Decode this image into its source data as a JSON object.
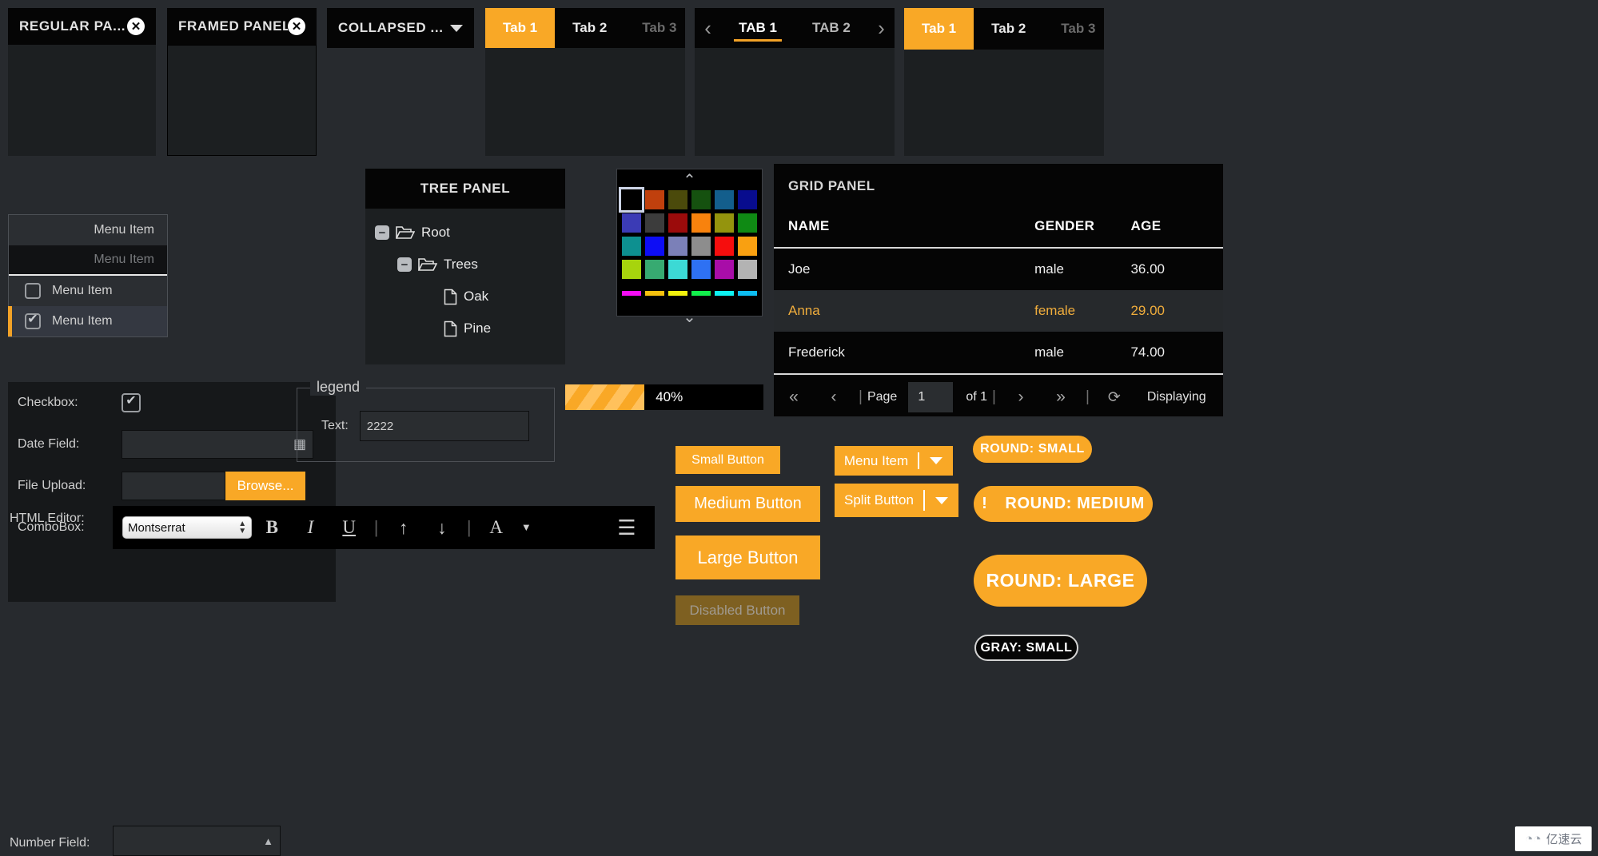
{
  "theme": {
    "accent": "#f9a826",
    "bg": "#272a2e",
    "panel_bg": "#1c1f21",
    "header_bg": "#050505",
    "text": "#d4d4d4"
  },
  "panels": {
    "regular": {
      "title": "REGULAR PA...",
      "close_icon": "close-circle-icon"
    },
    "framed": {
      "title": "FRAMED PANEL",
      "close_icon": "close-circle-icon"
    },
    "collapsed": {
      "title": "COLLAPSED ...",
      "expand_icon": "chevron-down-icon"
    },
    "tree": {
      "title": "TREE PANEL"
    },
    "grid": {
      "title": "GRID PANEL"
    }
  },
  "tabs_basic": {
    "items": [
      {
        "label": "Tab 1",
        "state": "active"
      },
      {
        "label": "Tab 2",
        "state": "normal"
      },
      {
        "label": "Tab 3",
        "state": "disabled"
      }
    ]
  },
  "tabs_scroll": {
    "prev_icon": "chevron-left-icon",
    "next_icon": "chevron-right-icon",
    "items": [
      {
        "label": "TAB 1",
        "state": "active"
      },
      {
        "label": "TAB 2",
        "state": "normal"
      }
    ]
  },
  "tabs_third": {
    "items": [
      {
        "label": "Tab 1",
        "state": "active"
      },
      {
        "label": "Tab 2",
        "state": "normal"
      },
      {
        "label": "Tab 3",
        "state": "disabled"
      }
    ]
  },
  "menu": {
    "items": [
      {
        "label": "Menu Item",
        "type": "plain",
        "state": "normal"
      },
      {
        "label": "Menu Item",
        "type": "plain",
        "state": "disabled"
      },
      {
        "label": "Menu Item",
        "type": "checkbox",
        "checked": false,
        "state": "normal"
      },
      {
        "label": "Menu Item",
        "type": "checkbox",
        "checked": true,
        "state": "selected"
      }
    ]
  },
  "form": {
    "checkbox": {
      "label": "Checkbox:",
      "checked": true
    },
    "date": {
      "label": "Date Field:",
      "value": "",
      "icon": "calendar-icon"
    },
    "file": {
      "label": "File Upload:",
      "value": "",
      "button": "Browse..."
    },
    "combo": {
      "label": "ComboBox:",
      "value": "",
      "icon": "chevron-down-icon"
    },
    "html_editor": {
      "label": "HTML Editor:"
    },
    "number": {
      "label": "Number Field:",
      "value": ""
    }
  },
  "editor": {
    "font": "Montserrat",
    "buttons": [
      {
        "name": "bold-icon",
        "glyph": "B"
      },
      {
        "name": "italic-icon",
        "glyph": "I"
      },
      {
        "name": "underline-icon",
        "glyph": "U"
      },
      {
        "name": "increase-font-size-icon",
        "glyph": "↑"
      },
      {
        "name": "decrease-font-size-icon",
        "glyph": "↓"
      },
      {
        "name": "font-color-icon",
        "glyph": "A"
      },
      {
        "name": "source-edit-icon",
        "glyph": "☰"
      }
    ]
  },
  "tree": {
    "nodes": [
      {
        "label": "Root",
        "depth": 0,
        "type": "folder",
        "expanded": true
      },
      {
        "label": "Trees",
        "depth": 1,
        "type": "folder",
        "expanded": true
      },
      {
        "label": "Oak",
        "depth": 2,
        "type": "leaf"
      },
      {
        "label": "Pine",
        "depth": 2,
        "type": "leaf"
      }
    ]
  },
  "color_picker": {
    "up_icon": "chevron-up-icon",
    "down_icon": "chevron-down-icon",
    "selected_index": 0,
    "rows": [
      [
        "#000000",
        "#c0400d",
        "#4b4a0b",
        "#15510f",
        "#135e8c",
        "#080c8e"
      ],
      [
        "#3b3bb5",
        "#3c3c3c",
        "#9b0b0b",
        "#f8820d",
        "#94940d",
        "#0f8a14"
      ],
      [
        "#0d9090",
        "#0d0df5",
        "#7b80b8",
        "#8d8d8d",
        "#f60d0d",
        "#f9a011"
      ],
      [
        "#a7d40d",
        "#37aa71",
        "#3cd9d5",
        "#2e71f3",
        "#a80da8",
        "#b3b3b3"
      ]
    ],
    "strips": [
      "#f60df6",
      "#f5c10d",
      "#f1f10d",
      "#12ef4c",
      "#0df2f2",
      "#0dbdf2"
    ]
  },
  "grid": {
    "columns": [
      "NAME",
      "GENDER",
      "AGE"
    ],
    "rows": [
      {
        "name": "Joe",
        "gender": "male",
        "age": "36.00",
        "highlight": false
      },
      {
        "name": "Anna",
        "gender": "female",
        "age": "29.00",
        "highlight": true
      },
      {
        "name": "Frederick",
        "gender": "male",
        "age": "74.00",
        "highlight": false
      }
    ],
    "pager": {
      "first_icon": "double-chevron-left-icon",
      "prev_icon": "chevron-left-icon",
      "page_label": "Page",
      "page_value": "1",
      "of_label": "of 1",
      "next_icon": "chevron-right-icon",
      "last_icon": "double-chevron-right-icon",
      "refresh_icon": "refresh-icon",
      "status": "Displaying"
    }
  },
  "fieldset": {
    "legend": "legend",
    "text_label": "Text:",
    "text_value": "2222"
  },
  "progress": {
    "percent": 40,
    "label": "40%"
  },
  "buttons": {
    "small": "Small Button",
    "medium": "Medium Button",
    "large": "Large Button",
    "disabled": "Disabled Button",
    "menu_split": {
      "label": "Menu Item",
      "arrow_icon": "chevron-down-icon"
    },
    "split": {
      "label": "Split Button",
      "arrow_icon": "chevron-down-icon"
    },
    "round_small": "ROUND: SMALL",
    "round_medium": {
      "label": "ROUND: MEDIUM",
      "icon": "exclamation-icon",
      "icon_glyph": "!"
    },
    "round_large": "ROUND: LARGE",
    "gray_small": "GRAY: SMALL"
  },
  "watermark": {
    "text": "亿速云",
    "icon": "cloud-logo-icon"
  }
}
